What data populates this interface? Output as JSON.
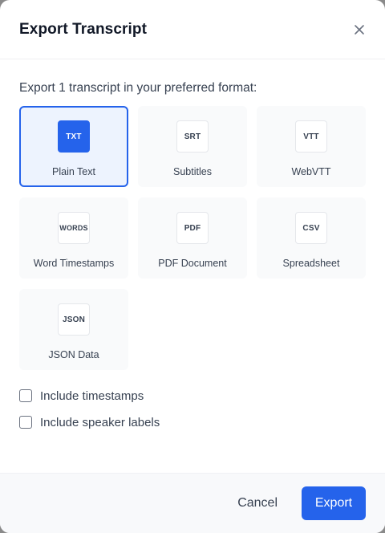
{
  "dialog": {
    "title": "Export Transcript",
    "subtitle": "Export 1 transcript in your preferred format:"
  },
  "formats": [
    {
      "badge": "TXT",
      "label": "Plain Text",
      "selected": true
    },
    {
      "badge": "SRT",
      "label": "Subtitles",
      "selected": false
    },
    {
      "badge": "VTT",
      "label": "WebVTT",
      "selected": false
    },
    {
      "badge": "WORDS",
      "label": "Word Timestamps",
      "selected": false
    },
    {
      "badge": "PDF",
      "label": "PDF Document",
      "selected": false
    },
    {
      "badge": "CSV",
      "label": "Spreadsheet",
      "selected": false
    },
    {
      "badge": "JSON",
      "label": "JSON Data",
      "selected": false
    }
  ],
  "options": [
    {
      "label": "Include timestamps",
      "checked": false
    },
    {
      "label": "Include speaker labels",
      "checked": false
    }
  ],
  "footer": {
    "cancel_label": "Cancel",
    "export_label": "Export"
  },
  "colors": {
    "accent": "#2563eb"
  },
  "icons": {
    "close": "close-icon"
  }
}
